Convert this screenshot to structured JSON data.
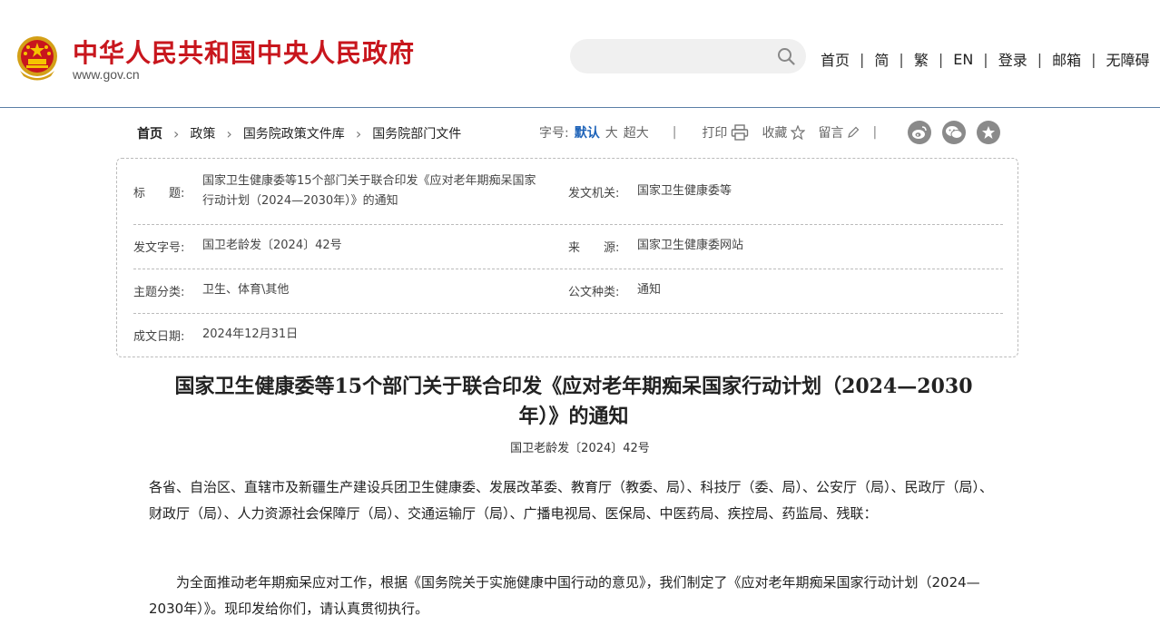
{
  "header": {
    "site_title": "中华人民共和国中央人民政府",
    "site_domain": "www.gov.cn",
    "search_placeholder": "",
    "nav": [
      "首页",
      "简",
      "繁",
      "EN",
      "登录",
      "邮箱",
      "无障碍"
    ],
    "nav_separator": "|"
  },
  "breadcrumb": {
    "items": [
      "首页",
      "政策",
      "国务院政策文件库",
      "国务院部门文件"
    ]
  },
  "tools": {
    "font_size_label": "字号:",
    "font_sizes": [
      "默认",
      "大",
      "超大"
    ],
    "active_font_size": "默认",
    "separator": "|",
    "print_label": "打印",
    "favorite_label": "收藏",
    "comment_label": "留言",
    "share_icons": [
      "weibo-icon",
      "wechat-icon",
      "star-share-icon"
    ]
  },
  "info_table": {
    "title_label": "标　　题:",
    "title_value": "国家卫生健康委等15个部门关于联合印发《应对老年期痴呆国家行动计划（2024—2030年）》的通知",
    "title_line1": "国家卫生健康委等15个部门关于联合印发《应对老年期痴呆国家",
    "title_line2": "行动计划（2024—2030年）》的通知",
    "issuer_label": "发文机关:",
    "issuer_value": "国家卫生健康委等",
    "doc_no_label": "发文字号:",
    "doc_no_value": "国卫老龄发〔2024〕42号",
    "source_label": "来　　源:",
    "source_value": "国家卫生健康委网站",
    "category_label": "主题分类:",
    "category_value": "卫生、体育\\其他",
    "type_label": "公文种类:",
    "type_value": "通知",
    "date_label": "成文日期:",
    "date_value": "2024年12月31日"
  },
  "article": {
    "title": "国家卫生健康委等15个部门关于联合印发《应对老年期痴呆国家行动计划（2024—2030年）》的通知",
    "title_line1": "国家卫生健康委等15个部门关于联合印发《应对老年期痴呆国家行动计划（2024—2030",
    "title_line2": "年）》的通知",
    "doc_number": "国卫老龄发〔2024〕42号",
    "addressee": "各省、自治区、直辖市及新疆生产建设兵团卫生健康委、发展改革委、教育厅（教委、局）、科技厅（委、局）、公安厅（局）、民政厅（局）、财政厅（局）、人力资源社会保障厅（局）、交通运输厅（局）、广播电视局、医保局、中医药局、疾控局、药监局、残联：",
    "body_p1": "为全面推动老年期痴呆应对工作，根据《国务院关于实施健康中国行动的意见》，我们制定了《应对老年期痴呆国家行动计划（2024—2030年）》。现印发给你们，请认真贯彻执行。"
  },
  "colors": {
    "brand_red": "#c8161d",
    "accent_blue": "#1d62b8",
    "divider": "#5b7fa6"
  }
}
